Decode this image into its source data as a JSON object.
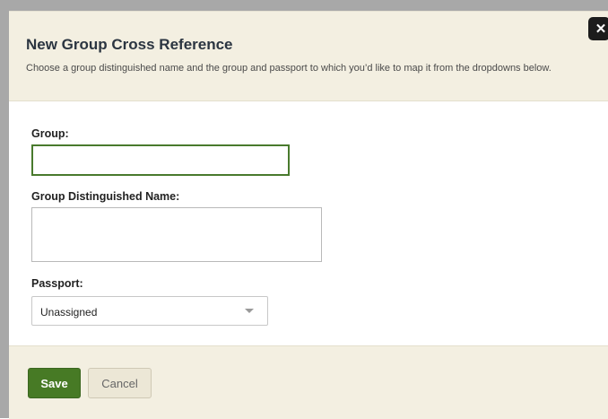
{
  "dialog": {
    "title": "New Group Cross Reference",
    "description": "Choose a group distinguished name and the group and passport to which you’d like to map it from the dropdowns below.",
    "close_label": "✕"
  },
  "form": {
    "group": {
      "label": "Group:",
      "value": ""
    },
    "group_dn": {
      "label": "Group Distinguished Name:",
      "value": ""
    },
    "passport": {
      "label": "Passport:",
      "selected": "Unassigned"
    }
  },
  "footer": {
    "save_label": "Save",
    "cancel_label": "Cancel"
  },
  "colors": {
    "accent": "#477a25",
    "header_bg": "#f3efe1",
    "title": "#2b3541"
  }
}
